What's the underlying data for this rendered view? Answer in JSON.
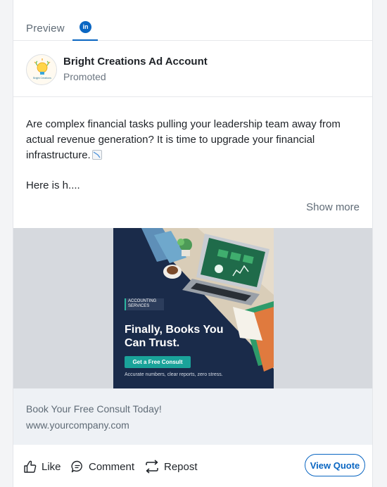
{
  "tabs": {
    "preview": "Preview",
    "network_badge": "in"
  },
  "account": {
    "name": "Bright Creations Ad Account",
    "subtitle": "Promoted",
    "logo_text": "Bright Creations"
  },
  "post": {
    "text_line1": "Are complex financial tasks pulling your leadership team away from actual revenue generation? It is time to upgrade your financial infrastructure.",
    "emoji_icon": "chart-decreasing-icon",
    "text_line2": "Here is h....",
    "show_more": "Show more"
  },
  "creative": {
    "tag": "ACCOUNTING SERVICES",
    "headline": "Finally, Books You Can Trust.",
    "cta": "Get a Free Consult",
    "footnote": "Accurate numbers, clear reports, zero stress."
  },
  "link": {
    "title": "Book Your Free Consult Today!",
    "url": "www.yourcompany.com"
  },
  "actions": {
    "like": "Like",
    "comment": "Comment",
    "repost": "Repost",
    "cta_button": "View Quote"
  },
  "colors": {
    "brand": "#0a66c2",
    "creative_bg": "#1a2b4a",
    "accent": "#1aa39a"
  }
}
